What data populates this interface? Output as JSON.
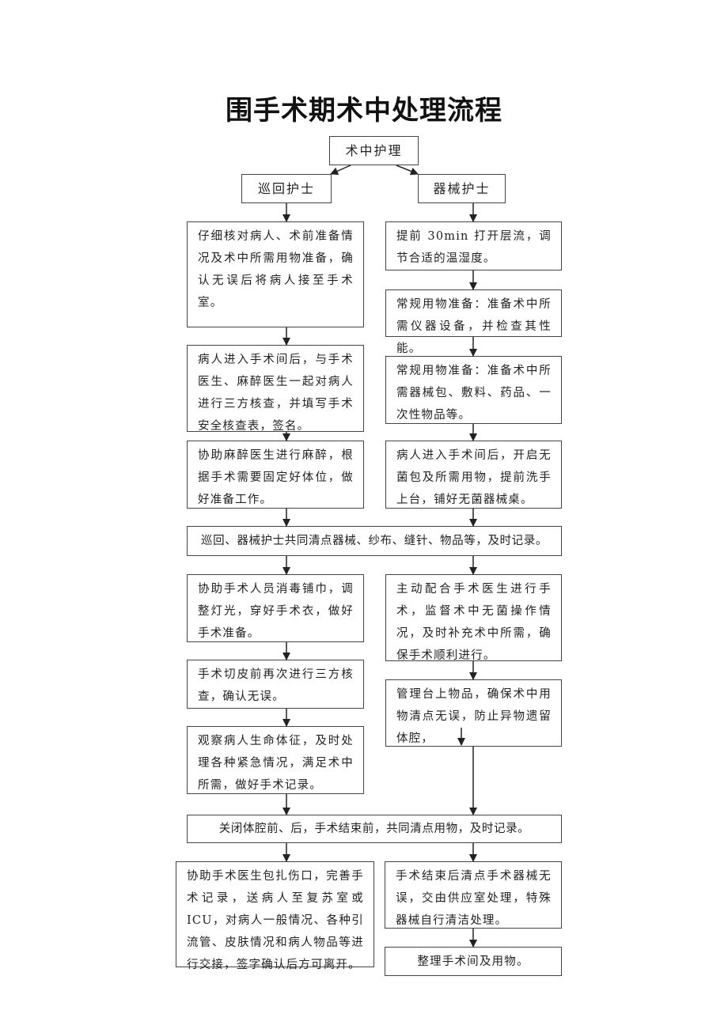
{
  "title": "围手术期术中处理流程",
  "root": "术中护理",
  "left_head": "巡回护士",
  "right_head": "器械护士",
  "left_steps_top": [
    "仔细核对病人、术前准备情况及术中所需用物准备，确认无误后将病人接至手术室。",
    "病人进入手术间后，与手术医生、麻醉医生一起对病人进行三方核查，并填写手术安全核查表，签名。",
    "协助麻醉医生进行麻醉，根据手术需要固定好体位，做好准备工作。"
  ],
  "right_steps_top": [
    "提前 30min 打开层流，调节合适的温湿度。",
    "常规用物准备：准备术中所需仪器设备，并检查其性能。",
    "常规用物准备：准备术中所需器械包、敷料、药品、一次性物品等。",
    "病人进入手术间后，开启无菌包及所需用物，提前洗手上台，铺好无菌器械桌。"
  ],
  "joint_count": "巡回、器械护士共同清点器械、纱布、缝针、物品等，及时记录。",
  "left_steps_mid": [
    "协助手术人员消毒铺巾，调整灯光，穿好手术衣，做好手术准备。",
    "手术切皮前再次进行三方核查，确认无误。",
    "观察病人生命体征，及时处理各种紧急情况，满足术中所需，做好手术记录。"
  ],
  "right_steps_mid": [
    "主动配合手术医生进行手术，监督术中无菌操作情况，及时补充术中所需，确保手术顺利进行。",
    "管理台上物品，确保术中用物清点无误，防止异物遗留体腔，"
  ],
  "closing_count": "关闭体腔前、后，手术结束前，共同清点用物，及时记录。",
  "left_final": "协助手术医生包扎伤口，完善手术记录，送病人至复苏室或 ICU，对病人一般情况、各种引流管、皮肤情况和病人物品等进行交接，签字确认后方可离开。",
  "right_final": [
    "手术结束后清点手术器械无误，交由供应室处理，特殊器械自行清洁处理。",
    "整理手术间及用物。"
  ]
}
